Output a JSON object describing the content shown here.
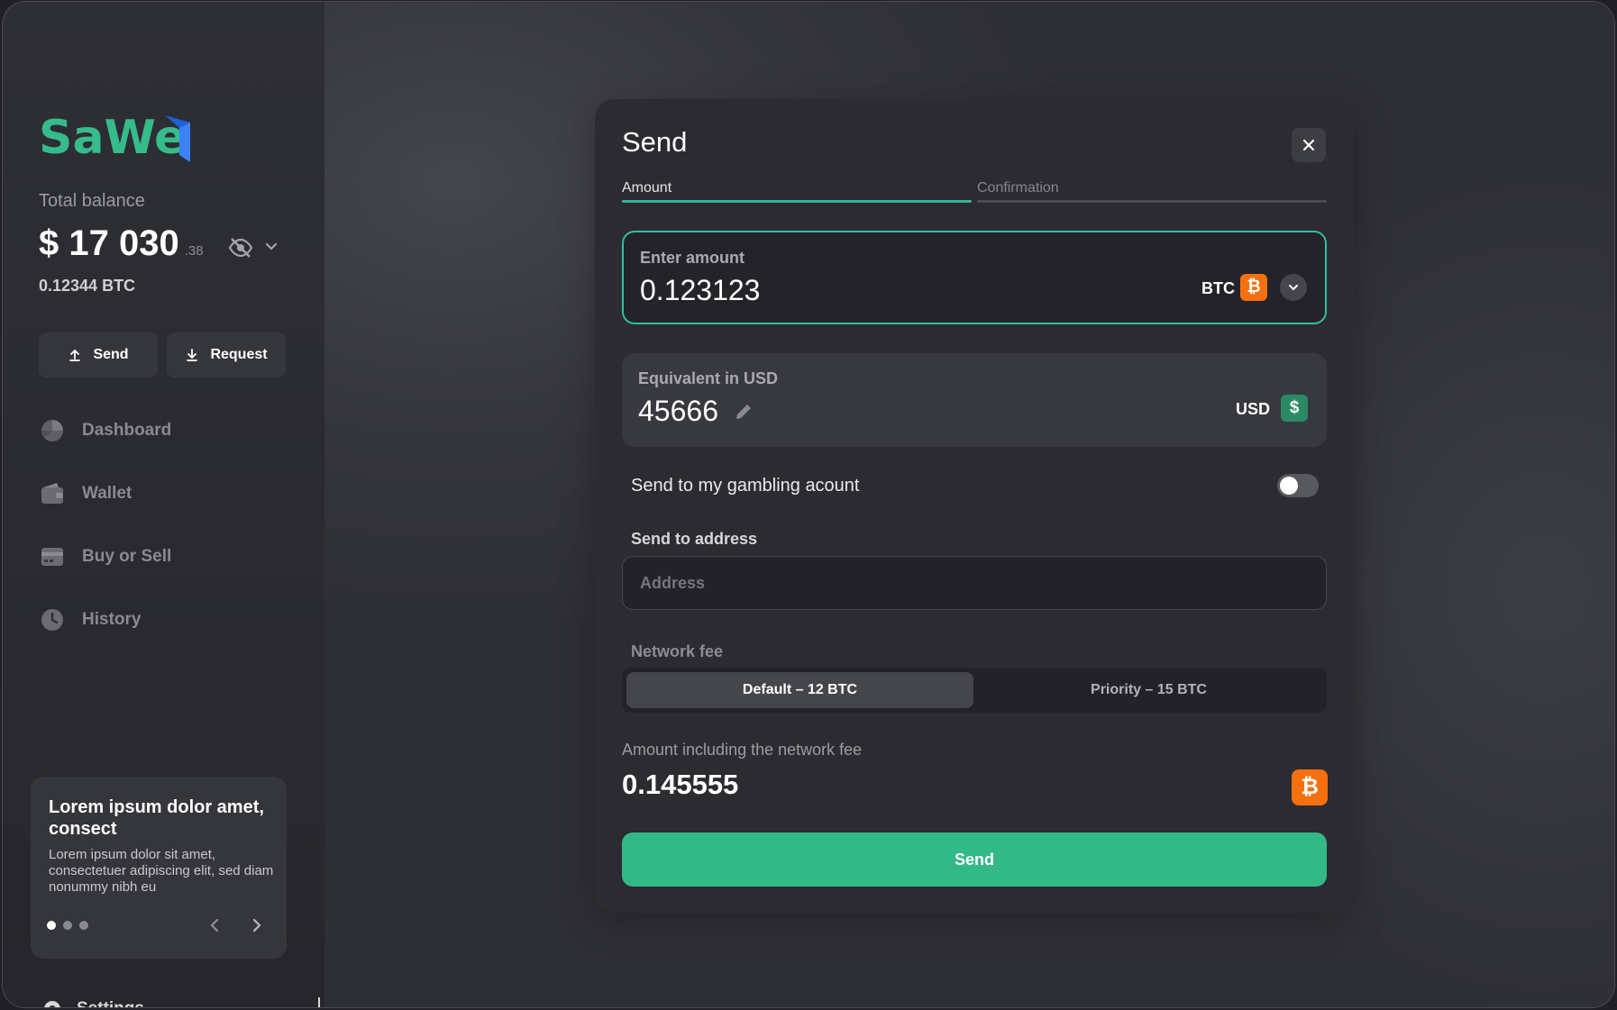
{
  "brand": {
    "logo_text": "SaWe"
  },
  "sidebar": {
    "total_label": "Total balance",
    "balance_main": "$ 17 030",
    "balance_cents": ".38",
    "btc_balance": "0.12344 BTC",
    "send_label": "Send",
    "request_label": "Request",
    "nav": [
      {
        "label": "Dashboard",
        "icon": "pie-chart-icon"
      },
      {
        "label": "Wallet",
        "icon": "wallet-icon"
      },
      {
        "label": "Buy or Sell",
        "icon": "card-icon"
      },
      {
        "label": "History",
        "icon": "clock-icon"
      }
    ],
    "promo": {
      "title": "Lorem ipsum dolor amet, consect",
      "body": "Lorem ipsum dolor sit amet, consectetuer adipiscing elit, sed diam nonummy nibh eu",
      "active_dot": 1,
      "dot_count": 3
    },
    "settings_label": "Settings"
  },
  "modal": {
    "title": "Send",
    "tabs": [
      {
        "label": "Amount",
        "active": true
      },
      {
        "label": "Confirmation",
        "active": false
      }
    ],
    "amount": {
      "label": "Enter amount",
      "value": "0.123123",
      "currency": "BTC",
      "currency_symbol": "₿"
    },
    "equivalent": {
      "label": "Equivalent in USD",
      "value": "45666",
      "currency": "USD",
      "currency_symbol": "$"
    },
    "gambling": {
      "label": "Send to my gambling acount",
      "enabled": false
    },
    "address": {
      "label": "Send to address",
      "placeholder": "Address",
      "value": ""
    },
    "fee": {
      "label": "Network fee",
      "options": [
        {
          "label": "Default – 12 BTC",
          "selected": true
        },
        {
          "label": "Priority – 15 BTC",
          "selected": false
        }
      ]
    },
    "total": {
      "label": "Amount including the network fee",
      "value": "0.145555",
      "currency_symbol": "₿"
    },
    "send_button": "Send"
  },
  "colors": {
    "accent_green": "#33b988",
    "focus_teal": "#33bda0",
    "bitcoin_orange": "#f6700f",
    "usd_green": "#2a8a66"
  }
}
